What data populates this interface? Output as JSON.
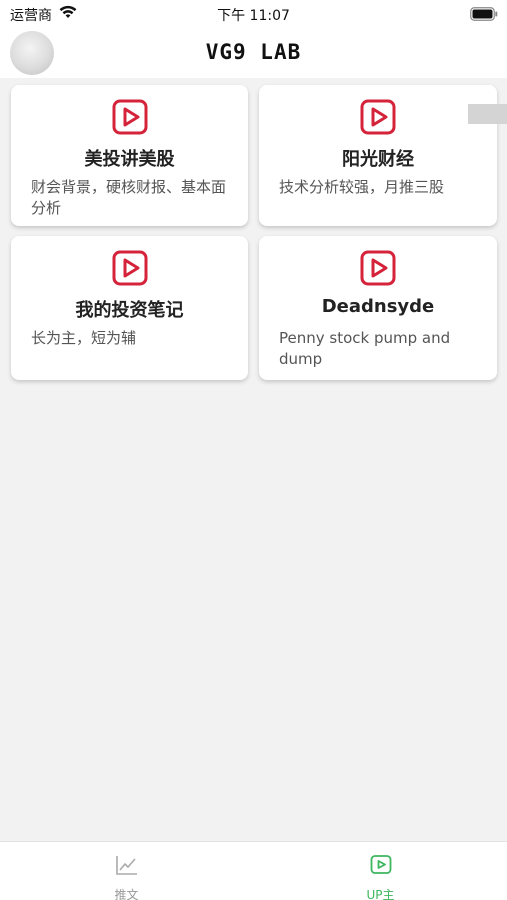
{
  "status_bar": {
    "carrier": "运营商",
    "time": "下午 11:07"
  },
  "header": {
    "title": "VG9 LAB"
  },
  "cards": [
    {
      "title": "美投讲美股",
      "desc": "财会背景，硬核财报、基本面分析"
    },
    {
      "title": "阳光财经",
      "desc": "技术分析较强，月推三股"
    },
    {
      "title": "我的投资笔记",
      "desc": "长为主，短为辅"
    },
    {
      "title": "Deadnsyde",
      "desc": "Penny stock pump and dump"
    }
  ],
  "tabs": [
    {
      "label": "推文",
      "icon": "chart-line-icon",
      "active": false
    },
    {
      "label": "UP主",
      "icon": "play-box-icon",
      "active": true
    }
  ],
  "colors": {
    "play_icon": "#d4233a",
    "tab_active": "#3db65d",
    "tab_inactive": "#999999"
  }
}
